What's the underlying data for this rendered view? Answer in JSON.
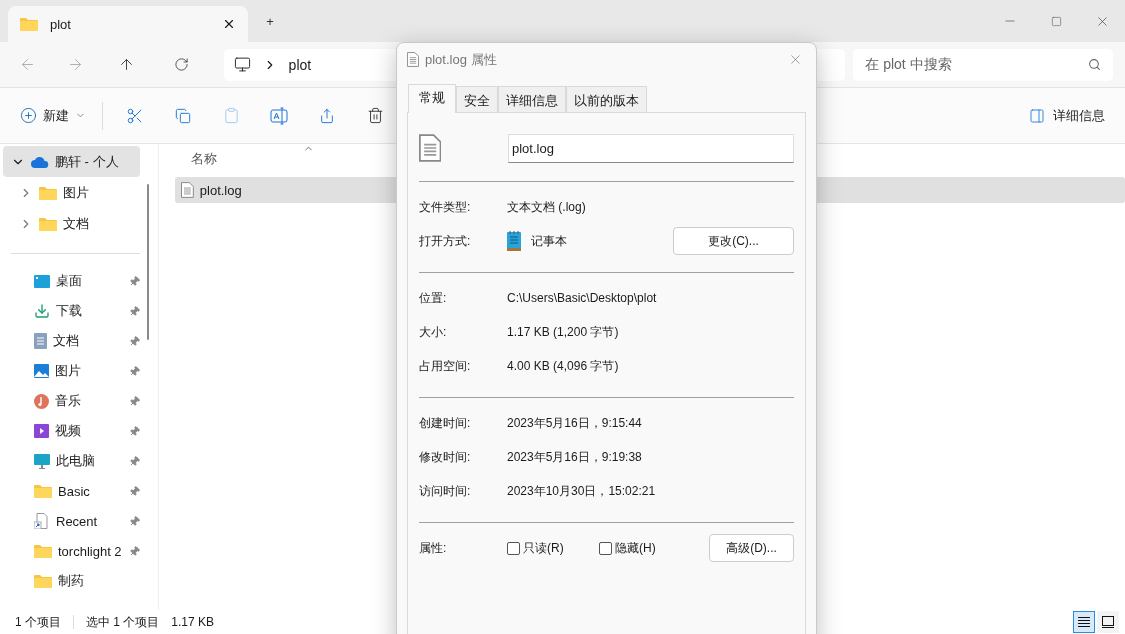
{
  "explorer": {
    "tab": {
      "title": "plot"
    },
    "new_tab": "+",
    "address": {
      "crumbs": [
        "plot"
      ]
    },
    "search": {
      "placeholder": "在 plot 中搜索"
    },
    "toolbar": {
      "new_label": "新建",
      "details_label": "详细信息"
    },
    "sidebar": {
      "tree": [
        {
          "label": "鹏轩 - 个人",
          "kind": "cloud",
          "expanded": true,
          "selected": true,
          "children": [
            {
              "label": "图片",
              "kind": "folder",
              "expanded": false,
              "selected": false
            },
            {
              "label": "文档",
              "kind": "folder",
              "expanded": false,
              "selected": false
            }
          ]
        }
      ],
      "quick_access": [
        {
          "label": "桌面",
          "kind": "desktop",
          "pinned": true
        },
        {
          "label": "下载",
          "kind": "download",
          "pinned": true
        },
        {
          "label": "文档",
          "kind": "document",
          "pinned": true
        },
        {
          "label": "图片",
          "kind": "pictures",
          "pinned": true
        },
        {
          "label": "音乐",
          "kind": "music",
          "pinned": true
        },
        {
          "label": "视频",
          "kind": "video",
          "pinned": true
        },
        {
          "label": "此电脑",
          "kind": "computer",
          "pinned": true
        },
        {
          "label": "Basic",
          "kind": "folder",
          "pinned": true
        },
        {
          "label": "Recent",
          "kind": "recent",
          "pinned": true
        },
        {
          "label": "torchlight 2",
          "kind": "folder",
          "pinned": true
        },
        {
          "label": "制药",
          "kind": "folder",
          "pinned": false
        }
      ]
    },
    "file_list": {
      "columns": [
        "名称"
      ],
      "rows": [
        {
          "name": "plot.log",
          "selected": true
        }
      ]
    },
    "status_bar": {
      "count": "1 个项目",
      "selection": "选中 1 个项目",
      "size": "1.17 KB"
    },
    "view_buttons": [
      {
        "kind": "details",
        "selected": true
      },
      {
        "kind": "tiles",
        "selected": false
      }
    ]
  },
  "dialog": {
    "title": "plot.log 属性",
    "tabs": [
      {
        "label": "常规",
        "selected": true
      },
      {
        "label": "安全",
        "selected": false
      },
      {
        "label": "详细信息",
        "selected": false
      },
      {
        "label": "以前的版本",
        "selected": false
      }
    ],
    "file_name": "plot.log",
    "sections": [
      [
        {
          "kind": "text",
          "label": "文件类型:",
          "value": "文本文档 (.log)"
        },
        {
          "kind": "app",
          "label": "打开方式:",
          "value": "记事本",
          "button": "更改(C)..."
        }
      ],
      [
        {
          "kind": "text",
          "label": "位置:",
          "value": "C:\\Users\\Basic\\Desktop\\plot"
        },
        {
          "kind": "text",
          "label": "大小:",
          "value": "1.17 KB (1,200 字节)"
        },
        {
          "kind": "text",
          "label": "占用空间:",
          "value": "4.00 KB (4,096 字节)"
        }
      ],
      [
        {
          "kind": "text",
          "label": "创建时间:",
          "value": "2023年5月16日，9:15:44"
        },
        {
          "kind": "text",
          "label": "修改时间:",
          "value": "2023年5月16日，9:19:38"
        },
        {
          "kind": "text",
          "label": "访问时间:",
          "value": "2023年10月30日，15:02:21"
        }
      ],
      [
        {
          "kind": "attributes",
          "label": "属性:",
          "checkboxes": [
            {
              "label": "只读(R)",
              "checked": false
            },
            {
              "label": "隐藏(H)",
              "checked": false
            }
          ],
          "button": "高级(D)..."
        }
      ]
    ]
  }
}
